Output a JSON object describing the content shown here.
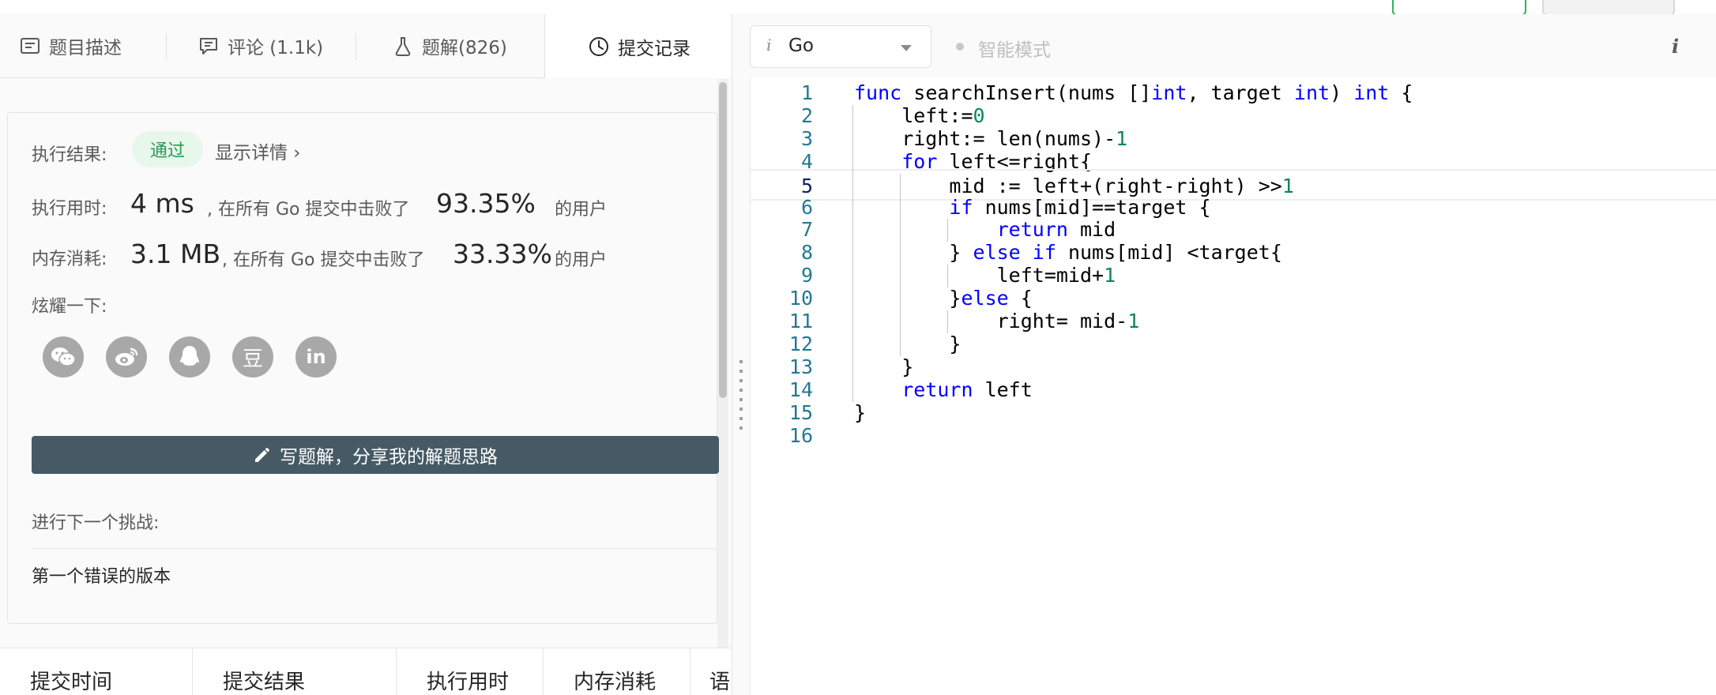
{
  "tabs": [
    {
      "label": "题目描述",
      "icon": "description-icon"
    },
    {
      "label": "评论 (1.1k)",
      "icon": "comment-icon"
    },
    {
      "label": "题解(826)",
      "icon": "flask-icon"
    },
    {
      "label": "提交记录",
      "icon": "clock-icon",
      "active": true
    }
  ],
  "result": {
    "exec_label": "执行结果:",
    "status": "通过",
    "detail_link": "显示详情 ›",
    "time_label": "执行用时:",
    "time_value": "4 ms",
    "time_text": ", 在所有 Go 提交中击败了",
    "time_percent": "93.35%",
    "time_suffix": "的用户",
    "mem_label": "内存消耗:",
    "mem_value": "3.1 MB",
    "mem_text": ", 在所有 Go 提交中击败了",
    "mem_percent": "33.33%",
    "mem_suffix": "的用户",
    "share_label": "炫耀一下:",
    "share_icons": [
      "wechat-icon",
      "weibo-icon",
      "qq-icon",
      "douban-icon",
      "linkedin-icon"
    ],
    "share_glyphs": [
      "",
      "",
      "",
      "豆",
      "in"
    ],
    "write_button": "写题解，分享我的解题思路",
    "next_label": "进行下一个挑战:",
    "next_item": "第一个错误的版本"
  },
  "history_headers": [
    "提交时间",
    "提交结果",
    "执行用时",
    "内存消耗",
    "语"
  ],
  "editor": {
    "language": "Go",
    "lang_info": "i",
    "mode": "智能模式",
    "info": "i",
    "accent": "#2db55d",
    "lines": [
      "func searchInsert(nums []int, target int) int {",
      "    left:=0",
      "    right:= len(nums)-1",
      "    for left<=right{",
      "        mid := left+(right-right) >>1",
      "        if nums[mid]==target {",
      "            return mid",
      "        } else if nums[mid] <target{",
      "            left=mid+1",
      "        }else {",
      "            right= mid-1",
      "        }",
      "    }",
      "    return left",
      "}",
      ""
    ],
    "current_line": 5
  }
}
